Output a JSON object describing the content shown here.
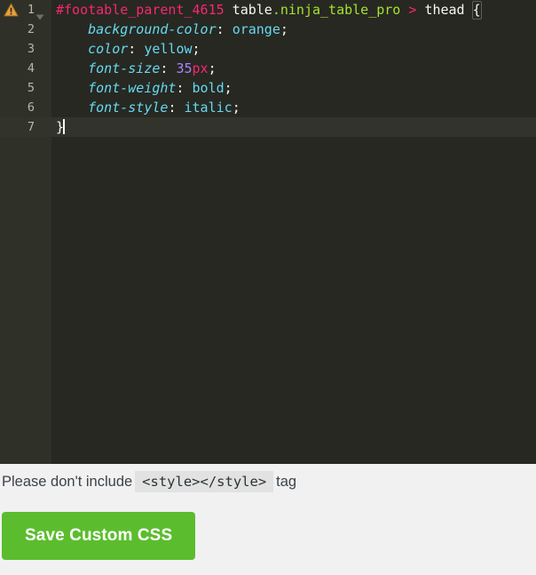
{
  "editor": {
    "language": "css",
    "theme_name": "monokai",
    "background_color": "#272822",
    "gutter_background_color": "#2f3129",
    "active_line_number": 7,
    "gutter": {
      "warning_icon": "warning-triangle-icon",
      "fold_icon": "chevron-down-fold-icon"
    },
    "lines": [
      {
        "number": "1",
        "tokens": [
          {
            "text": "#footable_parent_4615",
            "cls": "t-id"
          },
          {
            "text": " ",
            "cls": "t-punc"
          },
          {
            "text": "table",
            "cls": "t-tag"
          },
          {
            "text": ".ninja_table_pro",
            "cls": "t-class"
          },
          {
            "text": " ",
            "cls": "t-punc"
          },
          {
            "text": ">",
            "cls": "t-combi"
          },
          {
            "text": " ",
            "cls": "t-punc"
          },
          {
            "text": "thead",
            "cls": "t-tag"
          },
          {
            "text": " ",
            "cls": "t-punc"
          },
          {
            "text": "{",
            "cls": "brace-match"
          }
        ]
      },
      {
        "number": "2",
        "tokens": [
          {
            "text": "    ",
            "cls": "t-punc"
          },
          {
            "text": "background-color",
            "cls": "t-prop"
          },
          {
            "text": ":",
            "cls": "t-punc"
          },
          {
            "text": " ",
            "cls": "t-punc"
          },
          {
            "text": "orange",
            "cls": "t-val"
          },
          {
            "text": ";",
            "cls": "t-punc"
          }
        ]
      },
      {
        "number": "3",
        "tokens": [
          {
            "text": "    ",
            "cls": "t-punc"
          },
          {
            "text": "color",
            "cls": "t-prop"
          },
          {
            "text": ":",
            "cls": "t-punc"
          },
          {
            "text": " ",
            "cls": "t-punc"
          },
          {
            "text": "yellow",
            "cls": "t-val"
          },
          {
            "text": ";",
            "cls": "t-punc"
          }
        ]
      },
      {
        "number": "4",
        "tokens": [
          {
            "text": "    ",
            "cls": "t-punc"
          },
          {
            "text": "font-size",
            "cls": "t-prop"
          },
          {
            "text": ":",
            "cls": "t-punc"
          },
          {
            "text": " ",
            "cls": "t-punc"
          },
          {
            "text": "35",
            "cls": "t-num"
          },
          {
            "text": "px",
            "cls": "t-unit"
          },
          {
            "text": ";",
            "cls": "t-punc"
          }
        ]
      },
      {
        "number": "5",
        "tokens": [
          {
            "text": "    ",
            "cls": "t-punc"
          },
          {
            "text": "font-weight",
            "cls": "t-prop"
          },
          {
            "text": ":",
            "cls": "t-punc"
          },
          {
            "text": " ",
            "cls": "t-punc"
          },
          {
            "text": "bold",
            "cls": "t-val"
          },
          {
            "text": ";",
            "cls": "t-punc"
          }
        ]
      },
      {
        "number": "6",
        "tokens": [
          {
            "text": "    ",
            "cls": "t-punc"
          },
          {
            "text": "font-style",
            "cls": "t-prop"
          },
          {
            "text": ":",
            "cls": "t-punc"
          },
          {
            "text": " ",
            "cls": "t-punc"
          },
          {
            "text": "italic",
            "cls": "t-val"
          },
          {
            "text": ";",
            "cls": "t-punc"
          }
        ]
      },
      {
        "number": "7",
        "tokens": [
          {
            "text": "}",
            "cls": "t-brace"
          }
        ],
        "cursor": true
      }
    ],
    "full_text": "#footable_parent_4615 table.ninja_table_pro > thead {\n    background-color: orange;\n    color: yellow;\n    font-size: 35px;\n    font-weight: bold;\n    font-style: italic;\n}"
  },
  "note": {
    "prefix": "Please don't include",
    "code": "<style></style>",
    "suffix": "tag"
  },
  "footer": {
    "save_label": "Save Custom CSS",
    "save_color": "#5bbd2e"
  }
}
